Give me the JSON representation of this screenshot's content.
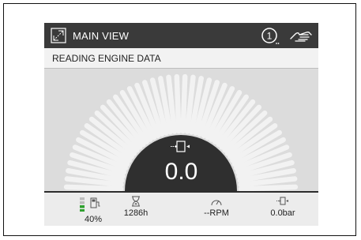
{
  "titlebar": {
    "title": "MAIN VIEW",
    "icon": "window-resize-icon",
    "alert_icon": "alert-number-icon",
    "alert_number": "1",
    "hand_icon": "hand-icon"
  },
  "status": {
    "message": "READING ENGINE DATA"
  },
  "gauge": {
    "value": "0.0",
    "icon": "pressure-sensor-icon"
  },
  "bottom": {
    "fuel": {
      "icon": "fuel-pump-icon",
      "value": "40%",
      "level": 0.4
    },
    "hours": {
      "icon": "hourglass-icon",
      "value": "1286h"
    },
    "rpm": {
      "icon": "speedometer-icon",
      "value": "--RPM"
    },
    "pressure": {
      "icon": "pressure-sensor-icon",
      "value": "0.0bar"
    }
  },
  "colors": {
    "titlebar": "#3a3a3a",
    "gauge_dial": "#2f2f2f",
    "gauge_ticks": "#f2f2f2",
    "fuel_level": "#2fa02f"
  }
}
